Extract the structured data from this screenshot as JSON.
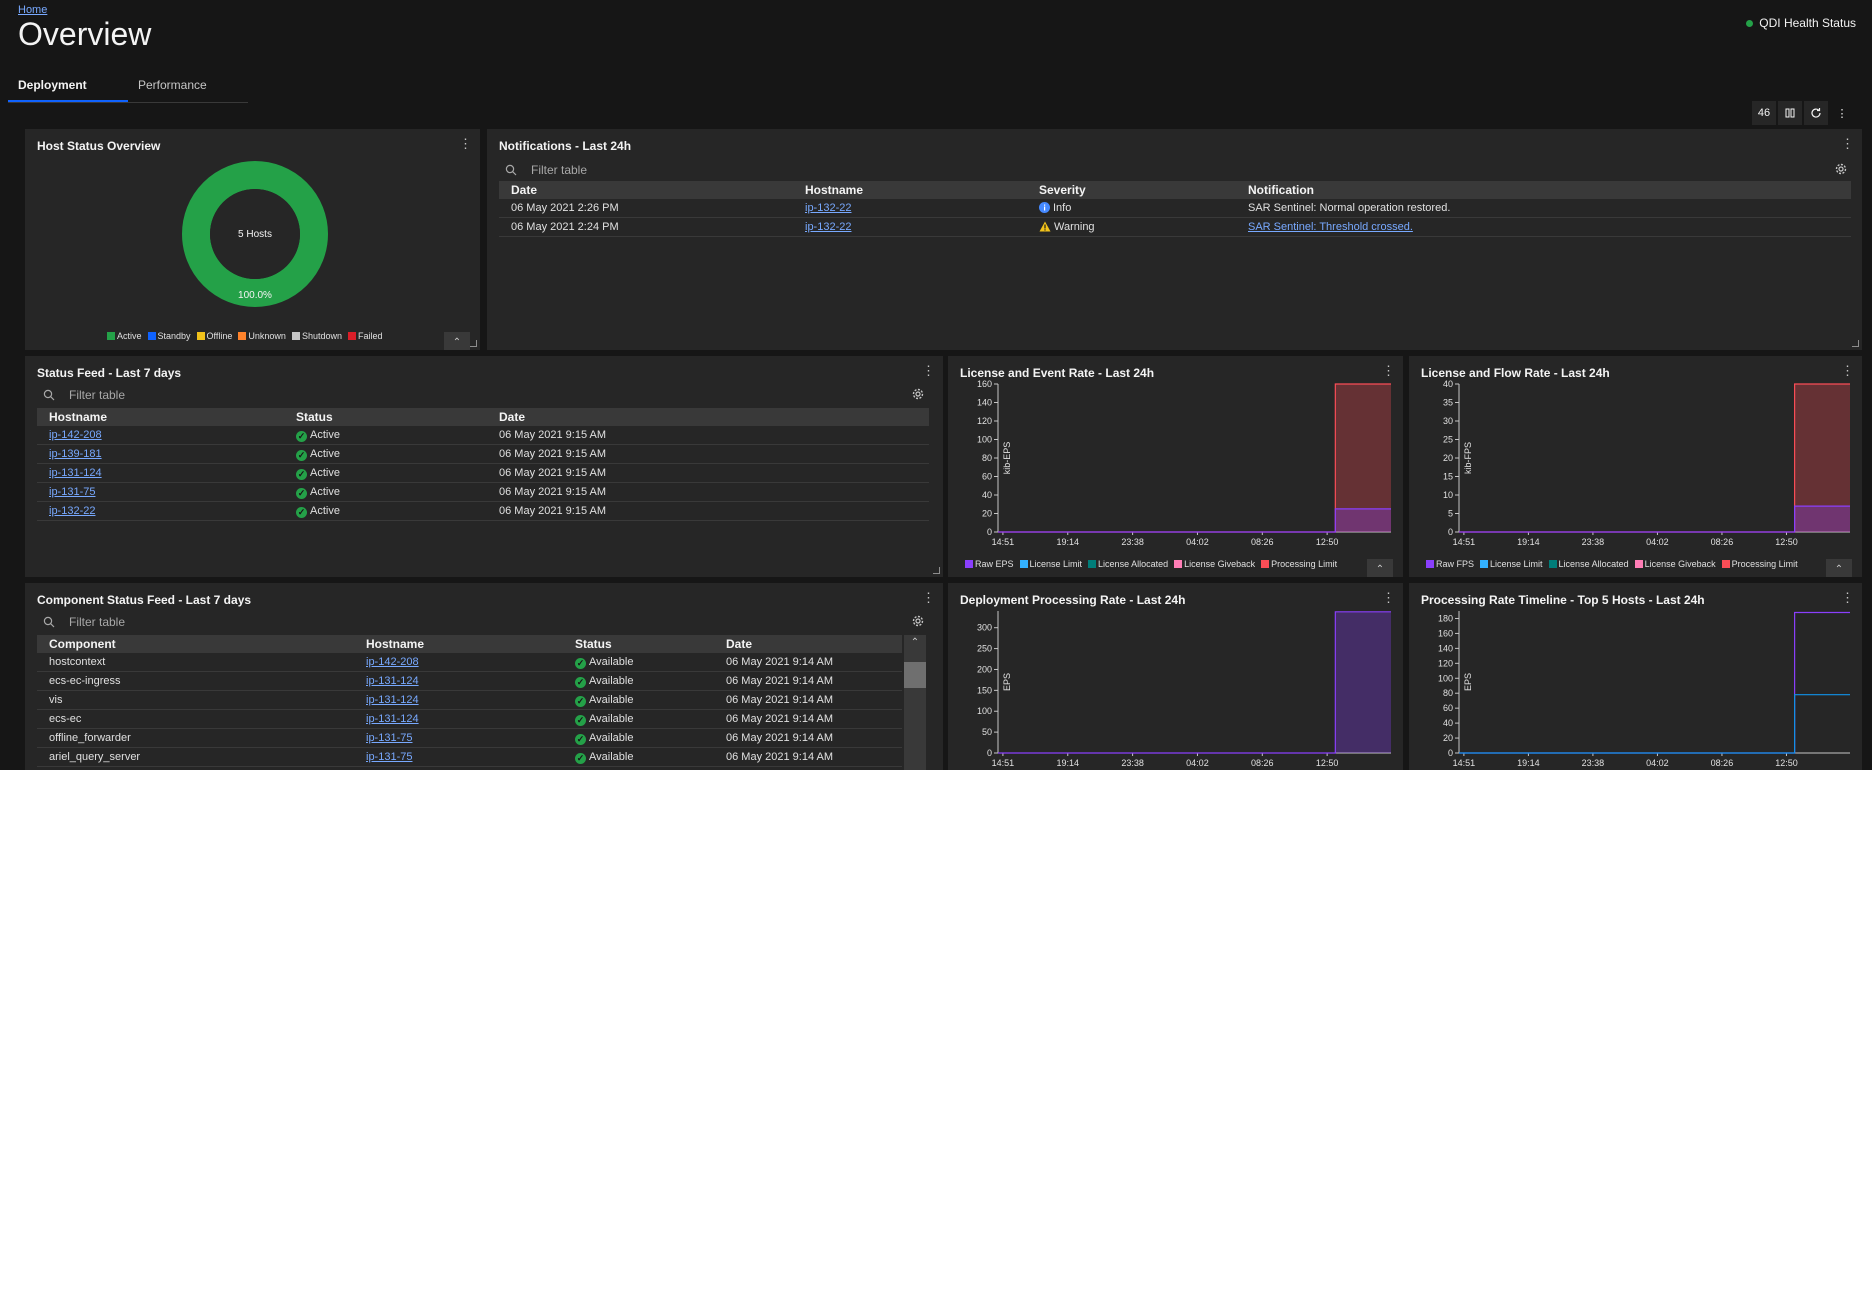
{
  "header": {
    "breadcrumb": "Home",
    "title": "Overview",
    "health_status": "QDI Health Status",
    "health_color": "#24a148"
  },
  "tabs": [
    {
      "label": "Deployment",
      "active": true
    },
    {
      "label": "Performance",
      "active": false
    }
  ],
  "toolbar": {
    "counter": "46"
  },
  "filter_placeholder": "Filter table",
  "host_status": {
    "title": "Host Status Overview",
    "center_label": "5 Hosts",
    "percent_label": "100.0%",
    "slices": [
      {
        "name": "Active",
        "value": 100.0
      }
    ],
    "legend": [
      {
        "name": "Active",
        "color": "#24a148"
      },
      {
        "name": "Standby",
        "color": "#0f62fe"
      },
      {
        "name": "Offline",
        "color": "#f1c21b"
      },
      {
        "name": "Unknown",
        "color": "#ff832b"
      },
      {
        "name": "Shutdown",
        "color": "#c6c6c6"
      },
      {
        "name": "Failed",
        "color": "#da1e28"
      }
    ]
  },
  "notifications": {
    "title": "Notifications - Last 24h",
    "columns": [
      "Date",
      "Hostname",
      "Severity",
      "Notification"
    ],
    "rows": [
      {
        "date": "06 May 2021 2:26 PM",
        "hostname": "ip-132-22",
        "severity": "Info",
        "notification": "SAR Sentinel: Normal operation restored."
      },
      {
        "date": "06 May 2021 2:24 PM",
        "hostname": "ip-132-22",
        "severity": "Warning",
        "notification": "SAR Sentinel: Threshold crossed."
      }
    ]
  },
  "status_feed": {
    "title": "Status Feed - Last 7 days",
    "columns": [
      "Hostname",
      "Status",
      "Date"
    ],
    "rows": [
      {
        "hostname": "ip-142-208",
        "status": "Active",
        "date": "06 May 2021 9:15 AM"
      },
      {
        "hostname": "ip-139-181",
        "status": "Active",
        "date": "06 May 2021 9:15 AM"
      },
      {
        "hostname": "ip-131-124",
        "status": "Active",
        "date": "06 May 2021 9:15 AM"
      },
      {
        "hostname": "ip-131-75",
        "status": "Active",
        "date": "06 May 2021 9:15 AM"
      },
      {
        "hostname": "ip-132-22",
        "status": "Active",
        "date": "06 May 2021 9:15 AM"
      }
    ]
  },
  "component_feed": {
    "title": "Component Status Feed - Last 7 days",
    "columns": [
      "Component",
      "Hostname",
      "Status",
      "Date"
    ],
    "rows": [
      {
        "component": "hostcontext",
        "hostname": "ip-142-208",
        "status": "Available",
        "date": "06 May 2021 9:14 AM"
      },
      {
        "component": "ecs-ec-ingress",
        "hostname": "ip-131-124",
        "status": "Available",
        "date": "06 May 2021 9:14 AM"
      },
      {
        "component": "vis",
        "hostname": "ip-131-124",
        "status": "Available",
        "date": "06 May 2021 9:14 AM"
      },
      {
        "component": "ecs-ec",
        "hostname": "ip-131-124",
        "status": "Available",
        "date": "06 May 2021 9:14 AM"
      },
      {
        "component": "offline_forwarder",
        "hostname": "ip-131-75",
        "status": "Available",
        "date": "06 May 2021 9:14 AM"
      },
      {
        "component": "ariel_query_server",
        "hostname": "ip-131-75",
        "status": "Available",
        "date": "06 May 2021 9:14 AM"
      }
    ]
  },
  "colors": {
    "raw": "#8a3ffc",
    "license_limit": "#33b1ff",
    "license_allocated": "#007d79",
    "license_giveback": "#ff7eb6",
    "processing_limit": "#fa4d56"
  },
  "chart_data": [
    {
      "id": "event",
      "type": "area",
      "title": "License and Event Rate - Last 24h",
      "ylabel": "kib-EPS",
      "ylim": [
        0,
        160
      ],
      "yticks": [
        0,
        20,
        40,
        60,
        80,
        100,
        120,
        140,
        160
      ],
      "xticks": [
        "14:51",
        "19:14",
        "23:38",
        "04:02",
        "08:26",
        "12:50"
      ],
      "xlim": [
        0,
        24
      ],
      "series": [
        {
          "name": "Processing Limit",
          "x": [
            0,
            20.6,
            20.6,
            24
          ],
          "y": [
            0,
            0,
            160,
            160
          ],
          "color": "#fa4d56"
        },
        {
          "name": "Raw EPS",
          "x": [
            0,
            20.6,
            20.6,
            24
          ],
          "y": [
            0,
            0,
            25,
            25
          ],
          "color": "#8a3ffc"
        }
      ],
      "legend": [
        "Raw EPS",
        "License Limit",
        "License Allocated",
        "License Giveback",
        "Processing Limit"
      ],
      "legend_colors": [
        "#8a3ffc",
        "#33b1ff",
        "#007d79",
        "#ff7eb6",
        "#fa4d56"
      ]
    },
    {
      "id": "flow",
      "type": "area",
      "title": "License and Flow Rate - Last 24h",
      "ylabel": "kib-FPS",
      "ylim": [
        0,
        40
      ],
      "yticks": [
        0,
        5,
        10,
        15,
        20,
        25,
        30,
        35,
        40
      ],
      "xticks": [
        "14:51",
        "19:14",
        "23:38",
        "04:02",
        "08:26",
        "12:50"
      ],
      "xlim": [
        0,
        24
      ],
      "series": [
        {
          "name": "Processing Limit",
          "x": [
            0,
            20.6,
            20.6,
            24
          ],
          "y": [
            0,
            0,
            40,
            40
          ],
          "color": "#fa4d56"
        },
        {
          "name": "Raw FPS",
          "x": [
            0,
            20.6,
            20.6,
            24
          ],
          "y": [
            0,
            0,
            7,
            7
          ],
          "color": "#8a3ffc"
        }
      ],
      "legend": [
        "Raw FPS",
        "License Limit",
        "License Allocated",
        "License Giveback",
        "Processing Limit"
      ],
      "legend_colors": [
        "#8a3ffc",
        "#33b1ff",
        "#007d79",
        "#ff7eb6",
        "#fa4d56"
      ]
    },
    {
      "id": "deploy",
      "type": "area",
      "title": "Deployment Processing Rate - Last 24h",
      "ylabel": "EPS",
      "ylim": [
        0,
        340
      ],
      "yticks": [
        0,
        50,
        100,
        150,
        200,
        250,
        300
      ],
      "xticks": [
        "14:51",
        "19:14",
        "23:38",
        "04:02",
        "08:26",
        "12:50"
      ],
      "xlim": [
        0,
        24
      ],
      "series": [
        {
          "x": [
            0,
            20.6,
            20.6,
            24
          ],
          "y": [
            0,
            0,
            338,
            338
          ],
          "color": "#8a3ffc"
        }
      ]
    },
    {
      "id": "top5",
      "type": "line",
      "title": "Processing Rate Timeline - Top 5 Hosts - Last 24h",
      "ylabel": "EPS",
      "ylim": [
        0,
        190
      ],
      "yticks": [
        0,
        20,
        40,
        60,
        80,
        100,
        120,
        140,
        160,
        180
      ],
      "xticks": [
        "14:51",
        "19:14",
        "23:38",
        "04:02",
        "08:26",
        "12:50"
      ],
      "xlim": [
        0,
        24
      ],
      "series": [
        {
          "x": [
            0,
            20.6,
            20.6,
            24
          ],
          "y": [
            0,
            0,
            188,
            188
          ],
          "color": "#8a3ffc"
        },
        {
          "x": [
            0,
            20.6,
            20.6,
            24
          ],
          "y": [
            0,
            0,
            78,
            78
          ],
          "color": "#1192e8"
        }
      ]
    }
  ]
}
